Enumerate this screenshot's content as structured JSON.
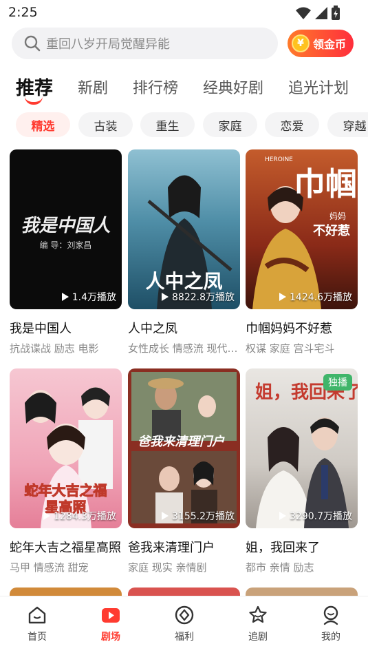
{
  "status_bar": {
    "time": "2:25"
  },
  "search": {
    "placeholder": "重回八岁开局觉醒异能"
  },
  "coin_button": {
    "label": "领金币",
    "coin_symbol": "¥"
  },
  "tabs": [
    {
      "label": "推荐",
      "active": true
    },
    {
      "label": "新剧"
    },
    {
      "label": "排行榜"
    },
    {
      "label": "经典好剧"
    },
    {
      "label": "追光计划"
    }
  ],
  "chips": [
    {
      "label": "精选",
      "active": true
    },
    {
      "label": "古装"
    },
    {
      "label": "重生"
    },
    {
      "label": "家庭"
    },
    {
      "label": "恋爱"
    },
    {
      "label": "穿越"
    }
  ],
  "cards": [
    {
      "title": "我是中国人",
      "tags": "抗战谍战 励志 电影",
      "plays": "1.4万播放",
      "poster_title": "我是中国人",
      "poster_credit": "编 导：刘家昌"
    },
    {
      "title": "人中之凤",
      "tags": "女性成长 情感流 现代言情",
      "plays": "8822.8万播放",
      "poster_title": "人中之凤"
    },
    {
      "title": "巾帼妈妈不好惹",
      "tags": "权谋 家庭 宫斗宅斗",
      "plays": "1424.6万播放",
      "poster_title": "巾帼",
      "poster_sub": "不好惹",
      "poster_small": "妈妈",
      "poster_heroine": "HEROINE"
    },
    {
      "title": "蛇年大吉之福星高照",
      "tags": "马甲 情感流 甜宠",
      "plays": "1284.3万播放",
      "poster_title": "蛇年大吉之福星高照"
    },
    {
      "title": "爸我来清理门户",
      "tags": "家庭 现实 亲情剧",
      "plays": "3155.2万播放",
      "poster_title": "爸我来清理门户"
    },
    {
      "title": "姐，我回来了",
      "tags": "都市 亲情 励志",
      "plays": "3290.7万播放",
      "poster_title": "姐，我回来了",
      "badge": "独播"
    }
  ],
  "bottom_nav": [
    {
      "label": "首页",
      "icon": "home-icon"
    },
    {
      "label": "剧场",
      "icon": "theater-icon",
      "active": true
    },
    {
      "label": "福利",
      "icon": "welfare-icon"
    },
    {
      "label": "追剧",
      "icon": "follow-icon"
    },
    {
      "label": "我的",
      "icon": "profile-icon"
    }
  ],
  "colors": {
    "accent": "#ff3b30",
    "badge": "#3fb56a",
    "coin": "#ffc21f"
  }
}
